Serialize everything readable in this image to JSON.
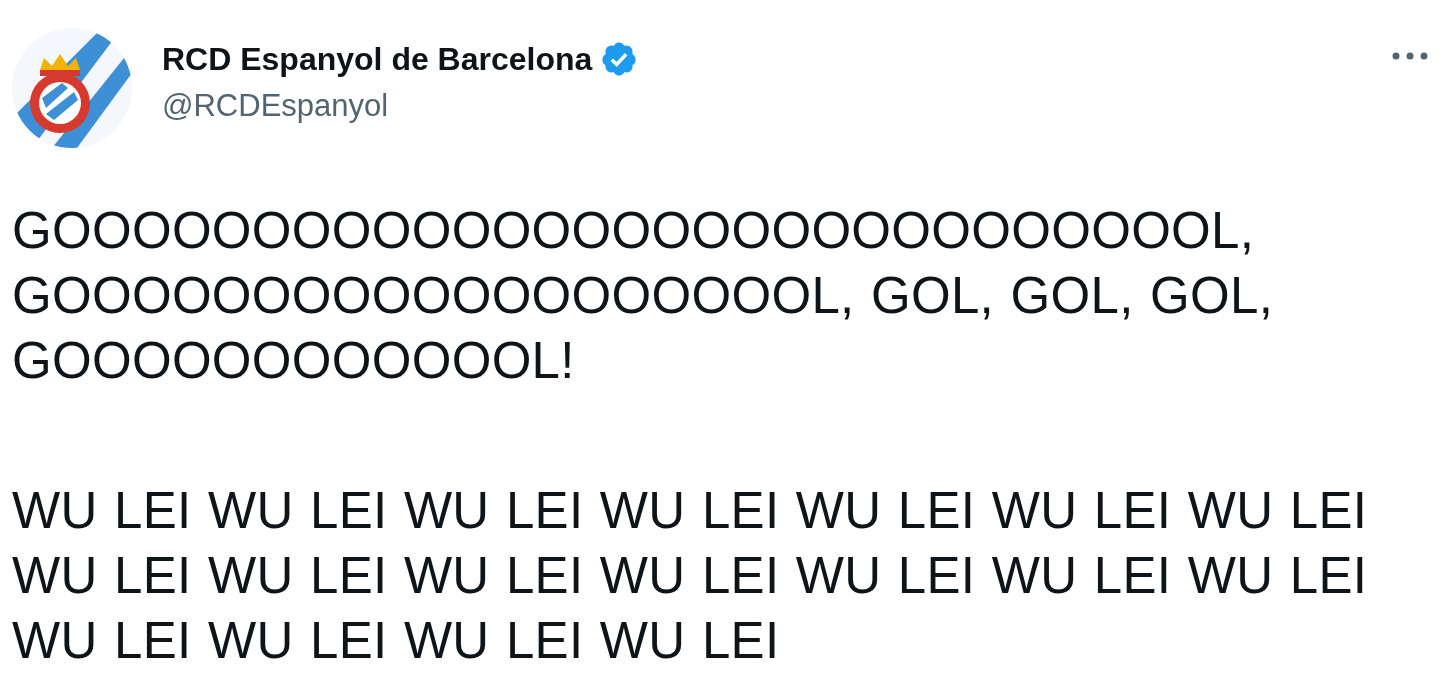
{
  "author": {
    "name": "RCD Espanyol de Barcelona",
    "verified": true,
    "handle": "@RCDEspanyol"
  },
  "paragraphs": [
    "GOOOOOOOOOOOOOOOOOOOOOOOOOOOOOL, GOOOOOOOOOOOOOOOOOOOL, GOL, GOL, GOL, GOOOOOOOOOOOOL!",
    "WU LEI WU LEI WU LEI WU LEI WU LEI WU LEI WU LEI WU LEI WU LEI WU LEI WU LEI WU LEI WU LEI WU LEI WU LEI WU LEI WU LEI WU LEI"
  ]
}
